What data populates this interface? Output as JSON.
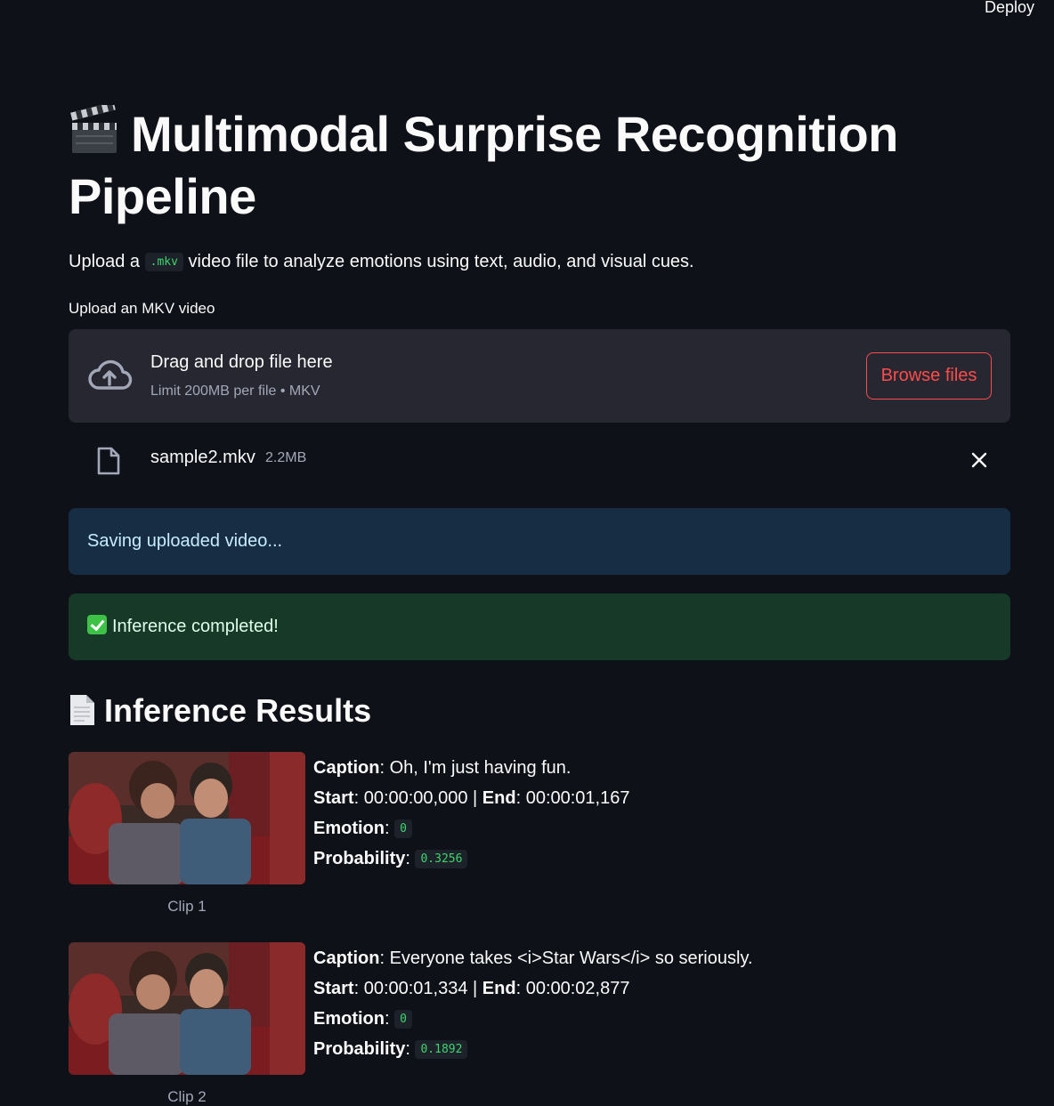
{
  "header": {
    "deploy_label": "Deploy"
  },
  "page": {
    "title": "Multimodal Surprise Recognition Pipeline",
    "title_icon": "clapper-board-icon",
    "intro_prefix": "Upload a",
    "intro_code": ".mkv",
    "intro_suffix": "video file to analyze emotions using text, audio, and visual cues."
  },
  "uploader": {
    "label": "Upload an MKV video",
    "drag_text": "Drag and drop file here",
    "limit_text": "Limit 200MB per file • MKV",
    "browse_label": "Browse files",
    "file_name": "sample2.mkv",
    "file_size": "2.2MB"
  },
  "alerts": {
    "info": "Saving uploaded video...",
    "success": "Inference completed!"
  },
  "results": {
    "title": "Inference Results",
    "title_icon": "document-icon",
    "labels": {
      "caption": "Caption",
      "start": "Start",
      "end": "End",
      "emotion": "Emotion",
      "probability": "Probability"
    },
    "clips": [
      {
        "name": "Clip 1",
        "caption": "Oh, I'm just having fun.",
        "start": "00:00:00,000",
        "end": "00:00:01,167",
        "emotion": "0",
        "probability": "0.3256"
      },
      {
        "name": "Clip 2",
        "caption": "Everyone takes <i>Star Wars</i> so seriously.",
        "start": "00:00:01,334",
        "end": "00:00:02,877",
        "emotion": "0",
        "probability": "0.1892"
      }
    ]
  },
  "colors": {
    "background": "#0e1117",
    "accent": "#ff4b4b",
    "code_text": "#3dd56d",
    "info_bg": "#172d43",
    "success_bg": "#173928"
  }
}
